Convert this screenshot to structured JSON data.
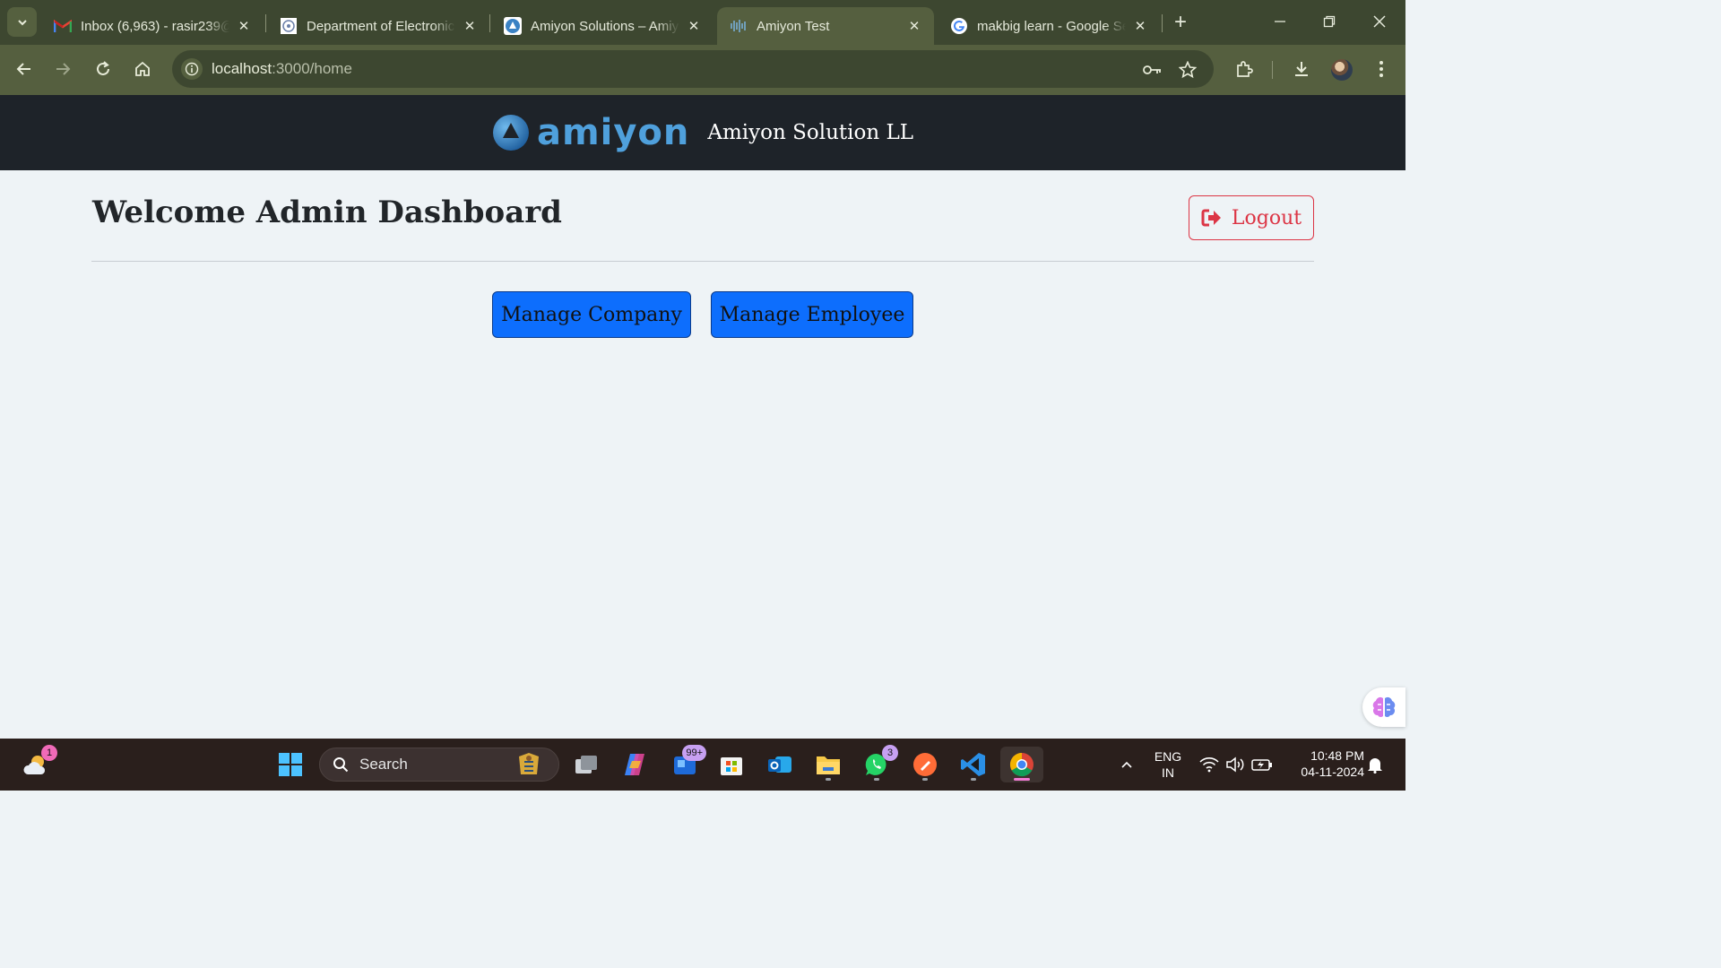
{
  "browser": {
    "tabs": [
      {
        "title": "Inbox (6,963) - rasir239@",
        "icon": "gmail-icon"
      },
      {
        "title": "Department of Electronic",
        "icon": "department-seal-icon"
      },
      {
        "title": "Amiyon Solutions – Amiy",
        "icon": "amiyon-icon"
      },
      {
        "title": "Amiyon Test",
        "icon": "audio-wave-icon",
        "active": true
      },
      {
        "title": "makbig learn - Google Se",
        "icon": "google-icon"
      }
    ],
    "url_host": "localhost",
    "url_path": ":3000/home"
  },
  "app": {
    "logo_word": "amiyon",
    "brand_name": "Amiyon Solution LL"
  },
  "page": {
    "title": "Welcome Admin Dashboard",
    "logout_label": "Logout",
    "buttons": {
      "manage_company": "Manage Company",
      "manage_employee": "Manage Employee"
    }
  },
  "colors": {
    "primary_button": "#0d6efd",
    "danger": "#dc3545",
    "header_bg": "#1e2329",
    "brand_blue": "#4fa0dc"
  },
  "taskbar": {
    "weather_badge": "1",
    "search_placeholder": "Search",
    "store_badge": "99+",
    "whatsapp_badge": "3",
    "language": "ENG",
    "region": "IN",
    "time": "10:48 PM",
    "date": "04-11-2024"
  }
}
